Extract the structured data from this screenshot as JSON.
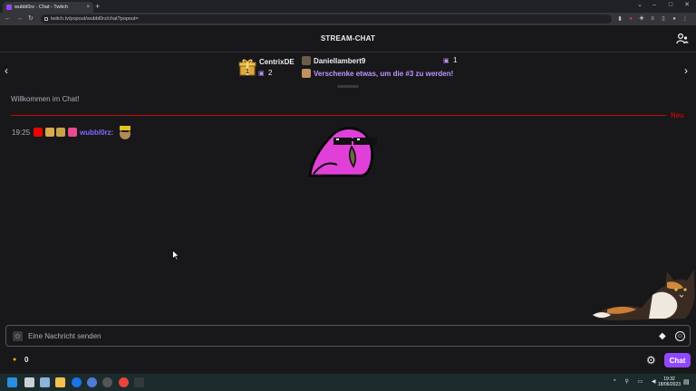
{
  "browser": {
    "tab_title": "wubbl0rz - Chat - Twitch",
    "tab_close": "×",
    "new_tab": "+",
    "url": "twitch.tv/popout/wubbl0rz/chat?popout=",
    "nav_back": "←",
    "nav_forward": "→",
    "nav_reload": "↻",
    "window_controls": [
      "⌄",
      "–",
      "□",
      "✕"
    ]
  },
  "chat": {
    "title": "STREAM-CHAT",
    "leaderboard": {
      "prev": "‹",
      "next": "›",
      "first": {
        "name": "CentrixDE",
        "count": "2"
      },
      "second": {
        "name": "Daniellambert9",
        "count": "1"
      },
      "third": {
        "text": "Verschenke etwas, um die #3 zu werden!"
      }
    },
    "welcome": "Willkommen im Chat!",
    "new_label": "Neu",
    "message": {
      "time": "19:25",
      "username": "wubbl0rz",
      "separator": ":"
    },
    "input": {
      "placeholder": "Eine Nachricht senden"
    },
    "points": "0",
    "chat_button": "Chat"
  },
  "taskbar": {
    "time": "19:32",
    "date": "18/06/2023"
  },
  "colors": {
    "accent": "#9147ff",
    "username": "#7d6bff",
    "new_divider": "#eb0400",
    "gift_text": "#bf94ff"
  },
  "icons": [
    "gift-icon",
    "users-icon",
    "bits-icon",
    "emoji-icon",
    "settings-icon",
    "channel-points-icon",
    "cursor-icon"
  ]
}
